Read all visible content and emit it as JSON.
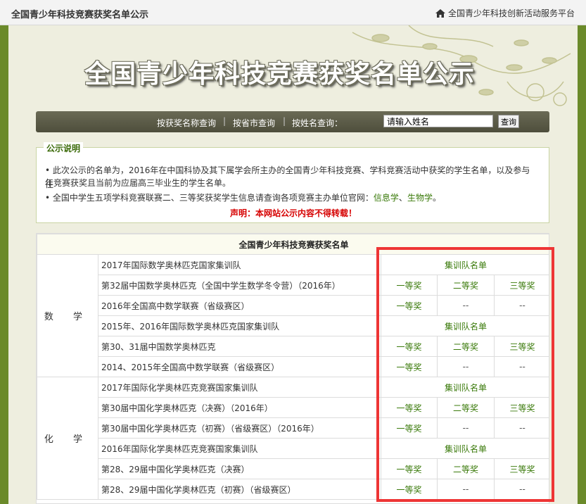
{
  "header": {
    "title": "全国青少年科技竞赛获奖名单公示",
    "home_link": "全国青少年科技创新活动服务平台"
  },
  "banner": {
    "title": "全国青少年科技竞赛获奖名单公示"
  },
  "search": {
    "by_award": "按获奖名称查询",
    "by_province": "按省市查询",
    "by_name": "按姓名查询：",
    "sep": "|",
    "input_value": "请输入姓名",
    "button": "查询"
  },
  "notice": {
    "title": "公示说明",
    "line1a": "• 此次公示的名单为，2016年在中国科协及其下属学会所主办的全国青少年科技竞赛、学科竞赛活动中获奖的学生名单，以及参与往",
    "line1b": "年竞赛获奖且当前为应届高三毕业生的学生名单。",
    "line2a": "• 全国中学生五项学科竞赛联赛二、三等奖获奖学生信息请查询各项竞赛主办单位官网：",
    "link1": "信息学",
    "comma": "、",
    "link2": "生物学",
    "period": "。",
    "declaration": "声明：本网站公示内容不得转载！"
  },
  "table": {
    "header": "全国青少年科技竞赛获奖名单",
    "groups": [
      {
        "subject": "数 学",
        "rows": [
          {
            "name": "2017年国际数学奥林匹克国家集训队",
            "team": "集训队名单"
          },
          {
            "name": "第32届中国数学奥林匹克（全国中学生数学冬令营）（2016年）",
            "a1": "一等奖",
            "a2": "二等奖",
            "a3": "三等奖"
          },
          {
            "name": "2016年全国高中数学联赛（省级赛区）",
            "a1": "一等奖",
            "a2": "--",
            "a3": "--"
          },
          {
            "name": "2015年、2016年国际数学奥林匹克国家集训队",
            "team": "集训队名单"
          },
          {
            "name": "第30、31届中国数学奥林匹克",
            "a1": "一等奖",
            "a2": "二等奖",
            "a3": "三等奖"
          },
          {
            "name": "2014、2015年全国高中数学联赛（省级赛区）",
            "a1": "一等奖",
            "a2": "--",
            "a3": "--"
          }
        ]
      },
      {
        "subject": "化 学",
        "rows": [
          {
            "name": "2017年国际化学奥林匹克竞赛国家集训队",
            "team": "集训队名单"
          },
          {
            "name": "第30届中国化学奥林匹克（决赛）（2016年）",
            "a1": "一等奖",
            "a2": "二等奖",
            "a3": "三等奖"
          },
          {
            "name": "第30届中国化学奥林匹克（初赛）（省级赛区）（2016年）",
            "a1": "一等奖",
            "a2": "--",
            "a3": "--"
          },
          {
            "name": "2016年国际化学奥林匹克竞赛国家集训队",
            "team": "集训队名单"
          },
          {
            "name": "第28、29届中国化学奥林匹克（决赛）",
            "a1": "一等奖",
            "a2": "二等奖",
            "a3": "三等奖"
          },
          {
            "name": "第28、29届中国化学奥林匹克（初赛）（省级赛区）",
            "a1": "一等奖",
            "a2": "--",
            "a3": "--"
          }
        ]
      }
    ]
  },
  "colors": {
    "accent_green": "#3a7a0a",
    "frame_green": "#6b8a2a",
    "highlight_red": "#ee3535",
    "declaration_red": "#d60000"
  }
}
